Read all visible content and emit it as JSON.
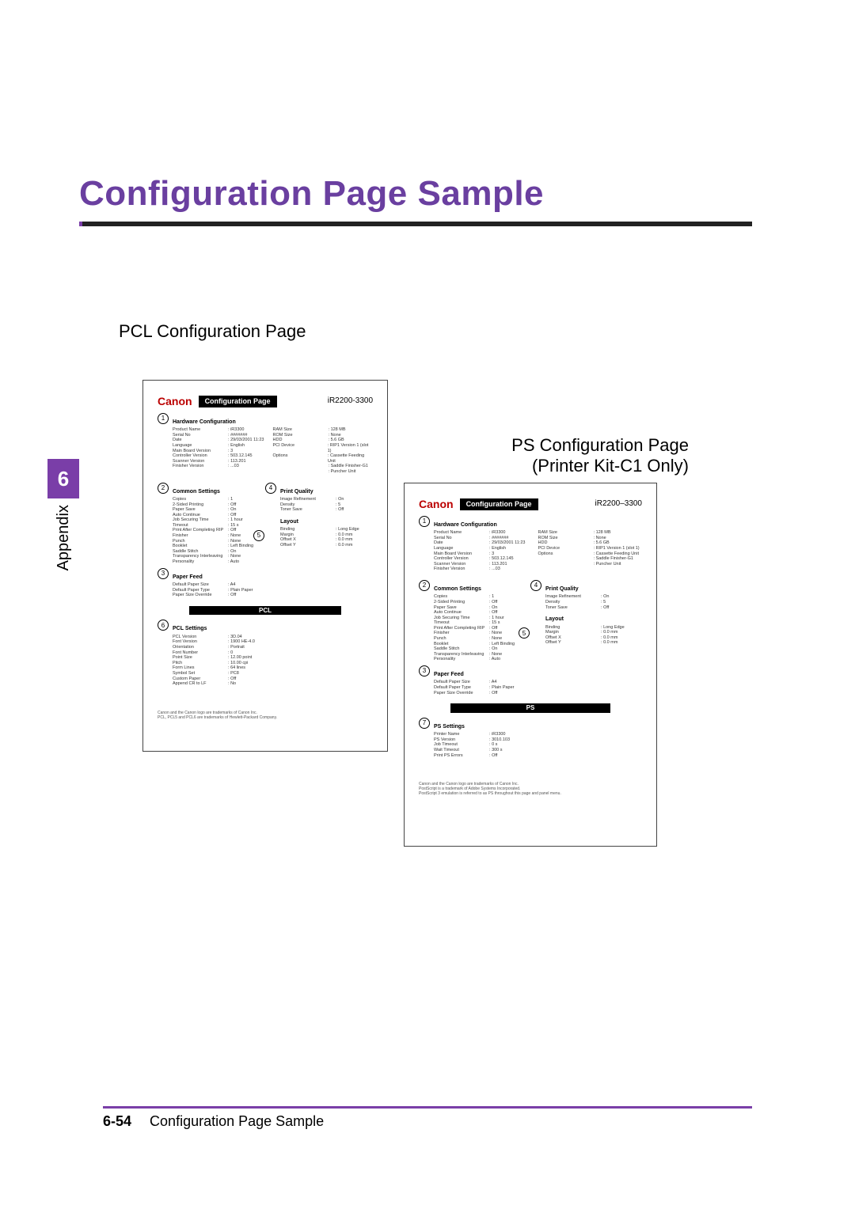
{
  "title": "Configuration Page Sample",
  "sidebar": {
    "chapter": "6",
    "label": "Appendix"
  },
  "sub1": "PCL Configuration Page",
  "ps_heading_line1": "PS Configuration Page",
  "ps_heading_line2": "(Printer Kit-C1 Only)",
  "footer": {
    "pagenum": "6-54",
    "title": "Configuration Page Sample"
  },
  "pcl_page": {
    "logo": "Canon",
    "pill": "Configuration Page",
    "model": "iR2200-3300",
    "hw_title": "Hardware Configuration",
    "hw_left": [
      [
        "Product Name",
        "iR3300"
      ],
      [
        "Serial No",
        "#######"
      ],
      [
        "Date",
        "29/03/2001 11:23"
      ],
      [
        "Language",
        "English"
      ],
      [
        "Main Board Version",
        "3"
      ],
      [
        "Controller Version",
        "503.12.145"
      ],
      [
        "Scanner Version",
        "113.201"
      ],
      [
        "Finisher Version",
        "...03"
      ]
    ],
    "hw_right": [
      [
        "RAM Size",
        "128 MB"
      ],
      [
        "ROM Size",
        "None"
      ],
      [
        "HDD",
        "5.6 GB"
      ],
      [
        "PCI Device",
        "RIP1 Version 1 (slot 1)"
      ],
      [
        "Options",
        "Cassette Feeding Unit"
      ],
      [
        "",
        "Saddle Finisher-G1"
      ],
      [
        "",
        "Puncher Unit"
      ]
    ],
    "common_title": "Common Settings",
    "common_left": [
      [
        "Copies",
        "1"
      ],
      [
        "2-Sided Printing",
        "Off"
      ],
      [
        "Paper Save",
        "On"
      ],
      [
        "Auto Continue",
        "Off"
      ],
      [
        "Job Securing Time",
        "1 hour"
      ],
      [
        "Timeout",
        "15 s"
      ],
      [
        "Print After Completing RIP",
        "Off"
      ],
      [
        "Finisher",
        "None"
      ],
      [
        "Punch",
        "None"
      ],
      [
        "Booklet",
        "Left Binding"
      ],
      [
        "Saddle Stitch",
        "On"
      ],
      [
        "Transparency Interleaving",
        "None"
      ],
      [
        "Personality",
        "Auto"
      ]
    ],
    "pq_title": "Print Quality",
    "pq": [
      [
        "Image Refinement",
        "On"
      ],
      [
        "Density",
        "5"
      ],
      [
        "Toner Save",
        "Off"
      ]
    ],
    "layout_title": "Layout",
    "layout": [
      [
        "Binding",
        "Long Edge"
      ],
      [
        "Margin",
        "0.0 mm"
      ],
      [
        "Offset X",
        "0.0 mm"
      ],
      [
        "Offset Y",
        "0.0 mm"
      ]
    ],
    "paper_title": "Paper Feed",
    "paper": [
      [
        "Default Paper Size",
        "A4"
      ],
      [
        "Default Paper Type",
        "Plain Paper"
      ],
      [
        "Paper Size Override",
        "Off"
      ]
    ],
    "pcl_band": "PCL",
    "pcls_title": "PCL Settings",
    "pcls": [
      [
        "PCL Version",
        "3D.04"
      ],
      [
        "Font Version",
        "1900 HE-4.0"
      ],
      [
        "Orientation",
        "Portrait"
      ],
      [
        "Font Number",
        "0"
      ],
      [
        "Point Size",
        "12.00 point"
      ],
      [
        "Pitch",
        "10.00 cpi"
      ],
      [
        "Form Lines",
        "64 lines"
      ],
      [
        "Symbol Set",
        "PC8"
      ],
      [
        "Custom Paper",
        "Off"
      ],
      [
        "Append CR to LF",
        "No"
      ]
    ],
    "foot1": "Canon and the Canon logo are trademarks of Canon Inc.",
    "foot2": "PCL, PCL5 and PCL6 are trademarks of Hewlett-Packard Company."
  },
  "ps_page": {
    "logo": "Canon",
    "pill": "Configuration Page",
    "model": "iR2200–3300",
    "hw_title": "Hardware Configuration",
    "hw_left": [
      [
        "Product Name",
        "iR3300"
      ],
      [
        "Serial No",
        "#######"
      ],
      [
        "Date",
        "29/03/2001 11:23"
      ],
      [
        "Language",
        "English"
      ],
      [
        "Main Board Version",
        "3"
      ],
      [
        "Controller Version",
        "503.12.145"
      ],
      [
        "Scanner Version",
        "113.201"
      ],
      [
        "Finisher Version",
        "...03"
      ]
    ],
    "hw_right": [
      [
        "RAM Size",
        "128 MB"
      ],
      [
        "ROM Size",
        "None"
      ],
      [
        "HDD",
        "5.6 GB"
      ],
      [
        "PCI Device",
        "RIP1 Version 1 (slot 1)"
      ],
      [
        "Options",
        "Cassette Feeding Unit"
      ],
      [
        "",
        "Saddle Finisher-G1"
      ],
      [
        "",
        "Puncher Unit"
      ]
    ],
    "common_title": "Common Settings",
    "common_left": [
      [
        "Copies",
        "1"
      ],
      [
        "2-Sided Printing",
        "Off"
      ],
      [
        "Paper Save",
        "On"
      ],
      [
        "Auto Continue",
        "Off"
      ],
      [
        "Job Securing Time",
        "1 hour"
      ],
      [
        "Timeout",
        "15 s"
      ],
      [
        "Print After Completing RIP",
        "Off"
      ],
      [
        "Finisher",
        "None"
      ],
      [
        "Punch",
        "None"
      ],
      [
        "Booklet",
        "Left Binding"
      ],
      [
        "Saddle Stitch",
        "On"
      ],
      [
        "Transparency Interleaving",
        "None"
      ],
      [
        "Personality",
        "Auto"
      ]
    ],
    "pq_title": "Print Quality",
    "pq": [
      [
        "Image Refinement",
        "On"
      ],
      [
        "Density",
        "5"
      ],
      [
        "Toner Save",
        "Off"
      ]
    ],
    "layout_title": "Layout",
    "layout": [
      [
        "Binding",
        "Long Edge"
      ],
      [
        "Margin",
        "0.0 mm"
      ],
      [
        "Offset X",
        "0.0 mm"
      ],
      [
        "Offset Y",
        "0.0 mm"
      ]
    ],
    "paper_title": "Paper Feed",
    "paper": [
      [
        "Default Paper Size",
        "A4"
      ],
      [
        "Default Paper Type",
        "Plain Paper"
      ],
      [
        "Paper Size Override",
        "Off"
      ]
    ],
    "ps_band": "PS",
    "pss_title": "PS Settings",
    "pss": [
      [
        "Printer Name",
        "iR3300"
      ],
      [
        "PS Version",
        "3010.103"
      ],
      [
        "Job Timeout",
        "0 s"
      ],
      [
        "Wait Timeout",
        "300 s"
      ],
      [
        "Print PS Errors",
        "Off"
      ]
    ],
    "foot1": "Canon and the Canon logo are trademarks of Canon Inc.",
    "foot2": "PostScript is a trademark of Adobe Systems Incorporated.",
    "foot3": "PostScript 3 emulation is referred to as PS throughout this page and panel menu."
  }
}
